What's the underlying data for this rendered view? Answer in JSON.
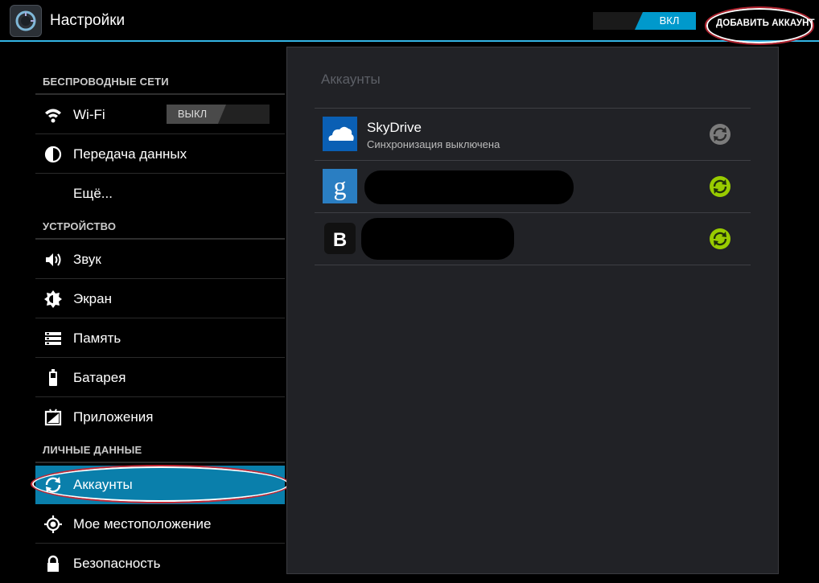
{
  "header": {
    "title": "Настройки",
    "master_toggle": "ВКЛ",
    "add_account": "ДОБАВИТЬ АККАУНТ"
  },
  "sidebar": {
    "sections": [
      {
        "title": "БЕСПРОВОДНЫЕ СЕТИ"
      },
      {
        "title": "УСТРОЙСТВО"
      },
      {
        "title": "ЛИЧНЫЕ ДАННЫЕ"
      }
    ],
    "items": [
      {
        "label": "Wi-Fi",
        "icon": "wifi-icon",
        "toggle": "ВЫКЛ"
      },
      {
        "label": "Передача данных",
        "icon": "data-usage-icon"
      },
      {
        "label": "Ещё..."
      },
      {
        "label": "Звук",
        "icon": "speaker-icon"
      },
      {
        "label": "Экран",
        "icon": "brightness-icon"
      },
      {
        "label": "Память",
        "icon": "storage-icon"
      },
      {
        "label": "Батарея",
        "icon": "battery-icon"
      },
      {
        "label": "Приложения",
        "icon": "apps-icon"
      },
      {
        "label": "Аккаунты",
        "icon": "sync-icon",
        "selected": true
      },
      {
        "label": "Мое местоположение",
        "icon": "location-icon"
      },
      {
        "label": "Безопасность",
        "icon": "lock-icon"
      }
    ]
  },
  "accounts": {
    "title": "Аккаунты",
    "list": [
      {
        "name": "SkyDrive",
        "status": "Синхронизация выключена",
        "logo": "skydrive-logo-icon",
        "sync_enabled": false
      },
      {
        "name": "",
        "status": "",
        "logo": "google-logo-icon",
        "sync_enabled": true
      },
      {
        "name": "",
        "status": "",
        "logo": "vk-logo-icon",
        "sync_enabled": true
      }
    ]
  },
  "colors": {
    "accent": "#33b5e5",
    "selected": "#0a7fab",
    "sync_on": "#99cc00",
    "sync_off": "#888888",
    "highlight_ring": "#c32734"
  }
}
